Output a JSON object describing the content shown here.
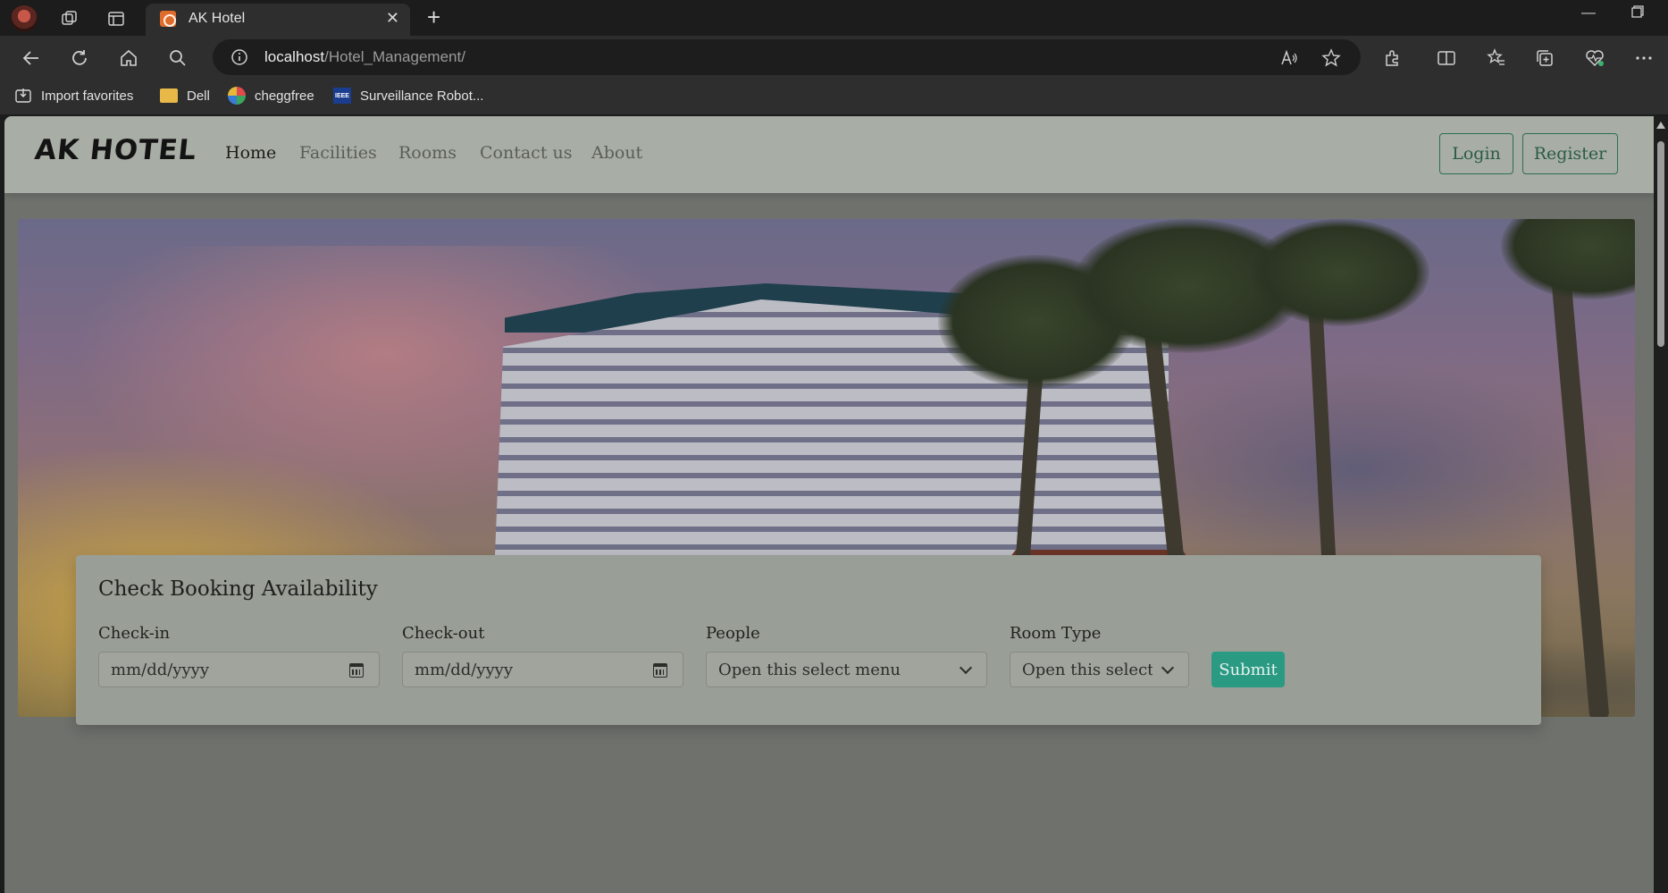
{
  "browser": {
    "tab_title": "AK Hotel",
    "url_host": "localhost",
    "url_path": "/Hotel_Management/",
    "bookmarks": [
      {
        "label": "Import favorites",
        "icon": "import-icon"
      },
      {
        "label": "Dell",
        "icon": "folder-icon"
      },
      {
        "label": "cheggfree",
        "icon": "chegg-icon"
      },
      {
        "label": "Surveillance Robot...",
        "icon": "ieee-icon"
      }
    ]
  },
  "site": {
    "brand": "AK HOTEL",
    "nav": [
      "Home",
      "Facilities",
      "Rooms",
      "Contact us",
      "About"
    ],
    "active_nav": "Home",
    "login_label": "Login",
    "register_label": "Register",
    "accent_color": "#2a9a83"
  },
  "booking": {
    "title": "Check Booking Availability",
    "checkin_label": "Check-in",
    "checkin_placeholder": "mm/dd/yyyy",
    "checkout_label": "Check-out",
    "checkout_placeholder": "mm/dd/yyyy",
    "people_label": "People",
    "people_value": "Open this select menu",
    "roomtype_label": "Room Type",
    "roomtype_value": "Open this select menu",
    "submit_label": "Submit"
  }
}
